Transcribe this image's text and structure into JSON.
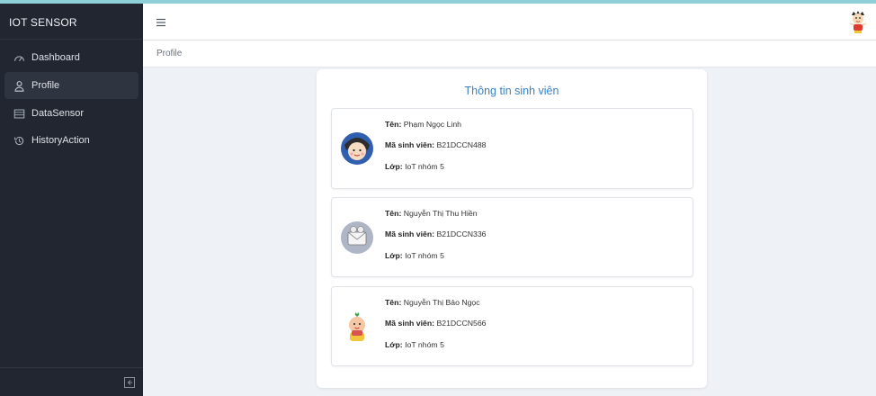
{
  "app": {
    "brand": "IOT SENSOR"
  },
  "sidebar": {
    "items": [
      {
        "label": "Dashboard",
        "icon": "speedometer-icon",
        "active": false
      },
      {
        "label": "Profile",
        "icon": "user-icon",
        "active": true
      },
      {
        "label": "DataSensor",
        "icon": "table-icon",
        "active": false
      },
      {
        "label": "HistoryAction",
        "icon": "history-icon",
        "active": false
      }
    ]
  },
  "header": {
    "menu_icon": "hamburger-icon",
    "avatar_icon": "user-avatar-icon"
  },
  "breadcrumb": {
    "current": "Profile"
  },
  "profile": {
    "title": "Thông tin sinh viên",
    "labels": {
      "name": "Tên:",
      "id": "Mã sinh viên:",
      "class": "Lớp:"
    },
    "students": [
      {
        "name": "Phạm Ngọc Linh",
        "id": "B21DCCN488",
        "class": "IoT nhóm 5",
        "avatar": "avatar-icon"
      },
      {
        "name": "Nguyễn Thị Thu Hiền",
        "id": "B21DCCN336",
        "class": "IoT nhóm 5",
        "avatar": "avatar-icon"
      },
      {
        "name": "Nguyễn Thị Bảo Ngọc",
        "id": "B21DCCN566",
        "class": "IoT nhóm 5",
        "avatar": "avatar-icon"
      }
    ]
  },
  "colors": {
    "sidebar_bg": "#212631",
    "accent": "#3b82c4",
    "page_bg": "#eef1f6"
  }
}
